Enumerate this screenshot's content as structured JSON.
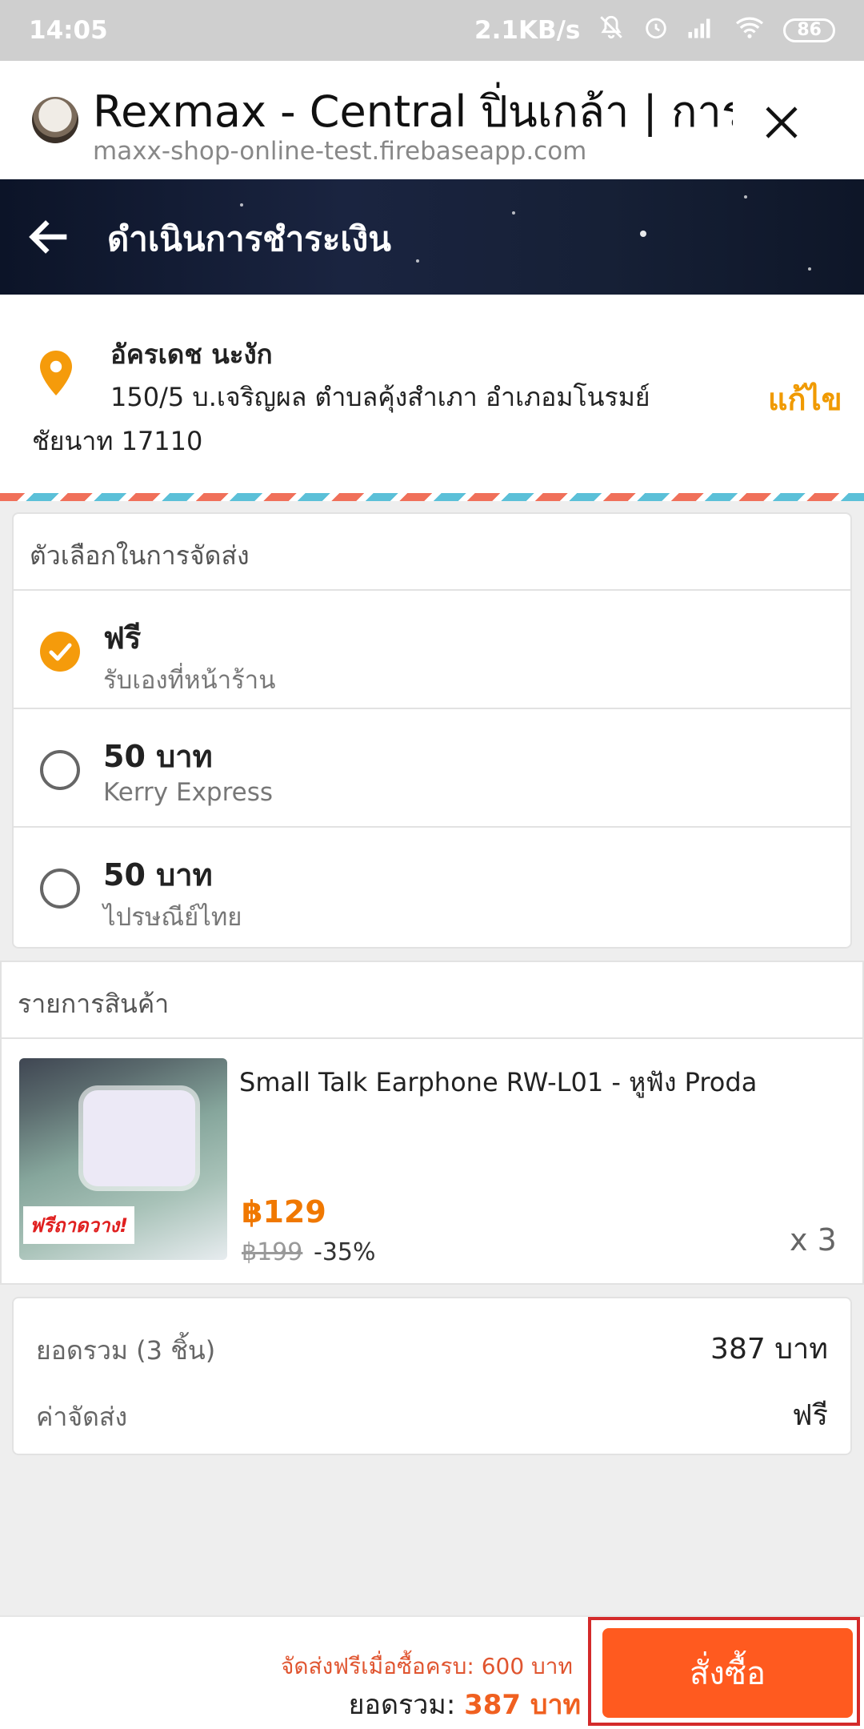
{
  "status_bar": {
    "time": "14:05",
    "network_speed": "2.1KB/s",
    "battery": "86",
    "icons": [
      "mute-icon",
      "alarm-icon",
      "signal-icon",
      "wifi-icon",
      "battery-icon"
    ]
  },
  "browser": {
    "title": "Rexmax - Central ปิ่นเกล้า | การ...",
    "url": "maxx-shop-online-test.firebaseapp.com"
  },
  "header": {
    "title": "ดำเนินการชำระเงิน"
  },
  "address": {
    "name": "อัครเดช นะงัก",
    "line1": "150/5 บ.เจริญผล ตำบลคุ้งสำเภา อำเภอมโนรมย์",
    "line2": "ชัยนาท 17110",
    "edit_label": "แก้ไข"
  },
  "shipping": {
    "heading": "ตัวเลือกในการจัดส่ง",
    "options": [
      {
        "main": "ฟรี",
        "sub": "รับเองที่หน้าร้าน",
        "selected": true
      },
      {
        "main": "50 บาท",
        "sub": "Kerry Express",
        "selected": false
      },
      {
        "main": "50 บาท",
        "sub": "ไปรษณีย์ไทย",
        "selected": false
      }
    ]
  },
  "products": {
    "heading": "รายการสินค้า",
    "items": [
      {
        "name": "Small Talk Earphone RW-L01 - หูฟัง Proda",
        "price": "฿129",
        "old_price": "฿199",
        "discount": "-35%",
        "quantity": "x 3",
        "image_badge": "ฟรีถาดวาง!"
      }
    ]
  },
  "summary": {
    "subtotal_label": "ยอดรวม (3 ชิ้น)",
    "subtotal_value": "387 บาท",
    "shipping_label": "ค่าจัดส่ง",
    "shipping_value": "ฟรี"
  },
  "footer": {
    "free_shipping_note": "จัดส่งฟรีเมื่อซื้อครบ: 600 บาท",
    "total_label": "ยอดรวม:",
    "total_value": "387 บาท",
    "order_button": "สั่งซื้อ"
  },
  "colors": {
    "accent_orange": "#ff5a1f",
    "price_orange": "#f07800",
    "edit_orange": "#f09a00",
    "check_orange": "#f59b0b",
    "highlight_red": "#d42a2a"
  }
}
